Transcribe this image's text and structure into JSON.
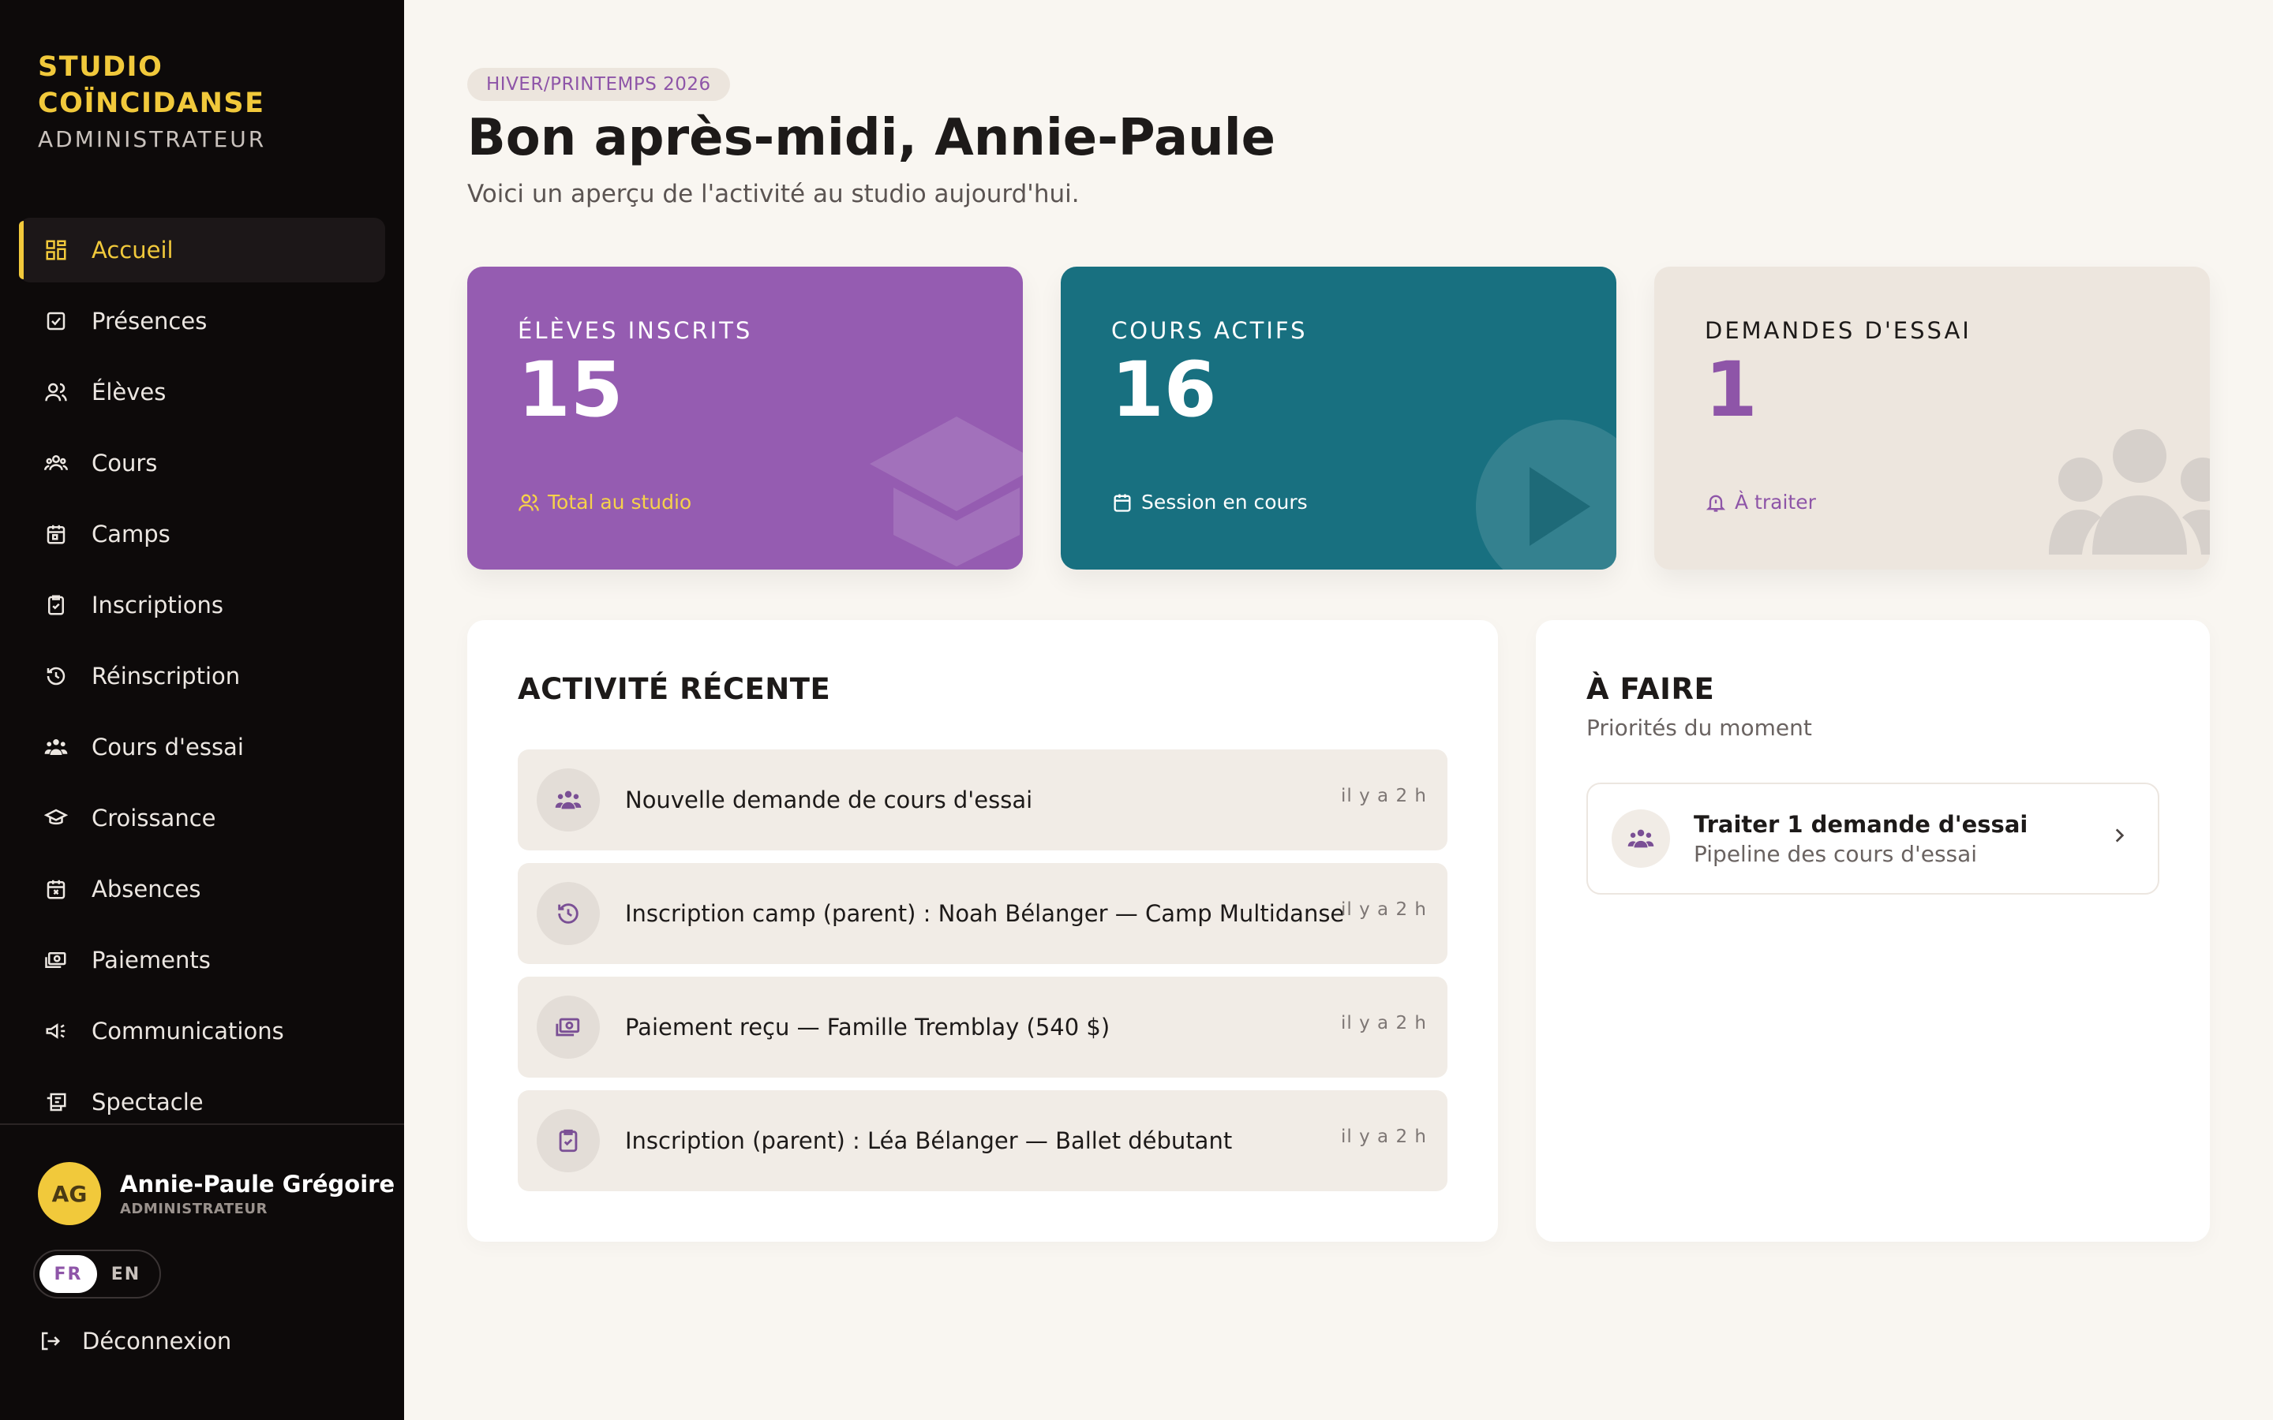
{
  "brand": {
    "name": "STUDIO COÏNCIDANSE",
    "role": "ADMINISTRATEUR"
  },
  "sidebar": {
    "items": [
      {
        "label": "Accueil",
        "icon": "dashboard-icon",
        "active": true
      },
      {
        "label": "Présences",
        "icon": "check-square-icon"
      },
      {
        "label": "Élèves",
        "icon": "users-icon"
      },
      {
        "label": "Cours",
        "icon": "group-icon"
      },
      {
        "label": "Camps",
        "icon": "calendar-icon"
      },
      {
        "label": "Inscriptions",
        "icon": "clipboard-check-icon"
      },
      {
        "label": "Réinscription",
        "icon": "history-icon"
      },
      {
        "label": "Cours d'essai",
        "icon": "people-group-icon"
      },
      {
        "label": "Croissance",
        "icon": "graduation-cap-icon"
      },
      {
        "label": "Absences",
        "icon": "calendar-x-icon"
      },
      {
        "label": "Paiements",
        "icon": "money-icon"
      },
      {
        "label": "Communications",
        "icon": "megaphone-icon"
      },
      {
        "label": "Spectacle",
        "icon": "ticket-icon"
      }
    ]
  },
  "user": {
    "initials": "AG",
    "name": "Annie-Paule Grégoire",
    "role": "ADMINISTRATEUR"
  },
  "language": {
    "fr": "FR",
    "en": "EN",
    "selected": "FR"
  },
  "logout_label": "Déconnexion",
  "header": {
    "season": "HIVER/PRINTEMPS 2026",
    "greeting": "Bon après-midi, Annie-Paule",
    "subtitle": "Voici un aperçu de l'activité au studio aujourd'hui."
  },
  "stats": [
    {
      "label": "ÉLÈVES INSCRITS",
      "value": "15",
      "foot": "Total au studio",
      "color": "#955cb1"
    },
    {
      "label": "COURS ACTIFS",
      "value": "16",
      "foot": "Session en cours",
      "color": "#187080"
    },
    {
      "label": "DEMANDES D'ESSAI",
      "value": "1",
      "foot": "À traiter",
      "color": "#ede6de"
    }
  ],
  "activity": {
    "title": "ACTIVITÉ RÉCENTE",
    "items": [
      {
        "text": "Nouvelle demande de cours d'essai",
        "time": "il y a 2 h",
        "icon": "people-group-icon"
      },
      {
        "text": "Inscription camp (parent) : Noah Bélanger — Camp Multidanse",
        "time": "il y a 2 h",
        "icon": "history-icon"
      },
      {
        "text": "Paiement reçu — Famille Tremblay (540 $)",
        "time": "il y a 2 h",
        "icon": "money-icon"
      },
      {
        "text": "Inscription (parent) : Léa Bélanger — Ballet débutant",
        "time": "il y a 2 h",
        "icon": "clipboard-check-icon"
      }
    ]
  },
  "todo": {
    "title": "À FAIRE",
    "subtitle": "Priorités du moment",
    "items": [
      {
        "title": "Traiter 1 demande d'essai",
        "subtitle": "Pipeline des cours d'essai",
        "icon": "people-group-icon"
      }
    ]
  },
  "colors": {
    "accent": "#f1c93b",
    "purple": "#955cb1",
    "teal": "#187080",
    "sidebar": "#0d0a0a",
    "background": "#f9f6f1"
  }
}
